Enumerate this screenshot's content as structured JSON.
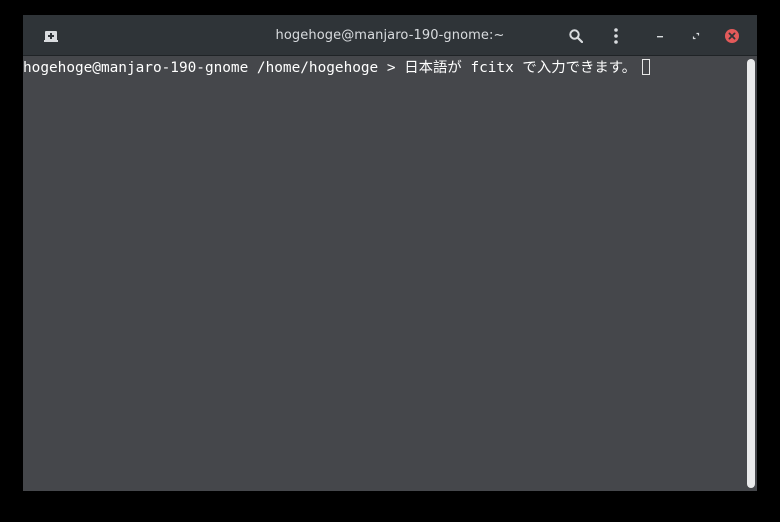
{
  "window": {
    "title": "hogehoge@manjaro-190-gnome:~"
  },
  "titlebar": {
    "new_tab_icon": "new-tab-icon",
    "search_icon": "search-icon",
    "menu_icon": "kebab-menu-icon",
    "minimize_icon": "minimize-icon",
    "maximize_icon": "maximize-icon",
    "close_icon": "close-icon",
    "close_color": "#e35a5a"
  },
  "terminal": {
    "prompt": "hogehoge@manjaro-190-gnome /home/hogehoge > ",
    "input": "日本語が fcitx で入力できます。"
  },
  "colors": {
    "titlebar_bg": "#2f3438",
    "terminal_bg": "#45474b",
    "text": "#ffffff"
  }
}
